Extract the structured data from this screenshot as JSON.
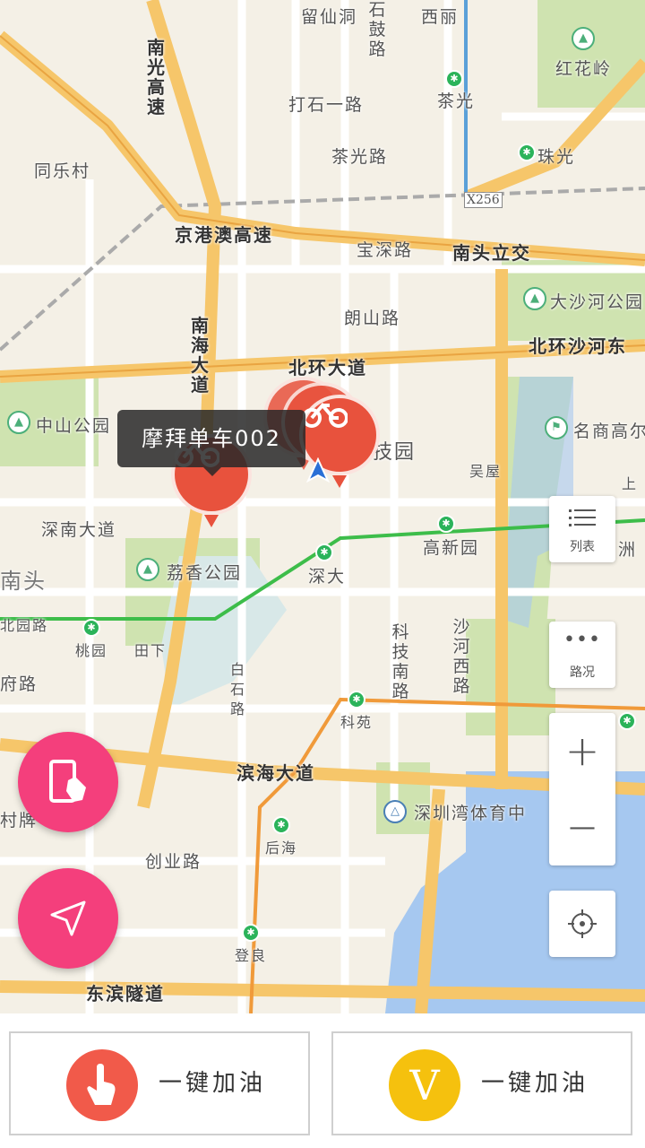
{
  "map": {
    "labels": {
      "liuxiandong": "留仙洞",
      "shigulu": "石鼓路",
      "xili": "西丽",
      "nanguanggaosu": "南光高速",
      "dashiyilu": "打石一路",
      "chaguang_station": "茶光",
      "honghualing": "红花岭",
      "tongle": "同乐村",
      "chaguanglu": "茶光路",
      "zhuguang": "珠光",
      "x256": "X256",
      "jinggangao": "京港澳高速",
      "baoshenlu": "宝深路",
      "nantoulijiao": "南头立交",
      "langshanlu": "朗山路",
      "dashahe_park": "大沙河公园",
      "nanhaidadao": "南海大道",
      "beihuandadao": "北环大道",
      "beihuan_shahe": "北环沙河东",
      "zhongshan_park": "中山公园",
      "keji_yuan": "科技园",
      "mingshang": "名商高尔",
      "wuwu": "吴屋",
      "shenandadao": "深南大道",
      "gaoxinyuan": "高新园",
      "lixiang_park": "荔香公园",
      "shenda": "深大",
      "nantou": "南头",
      "beihuanlu": "北园路",
      "taoyuan": "桃园",
      "tianxia": "田下",
      "kejinanlu": "科技南路",
      "shahexilu": "沙河西路",
      "fulu": "府路",
      "baishilu": "白石路",
      "keyuan": "科苑",
      "binhaidadao": "滨海大道",
      "shenzhenwan": "深圳湾体育中",
      "houhai": "后海",
      "cunpai": "村牌",
      "chuangyelu": "创业路",
      "dengliang": "登良",
      "dongbinsuidao": "东滨隧道",
      "zhou": "洲",
      "shang": "上"
    },
    "tooltip": "摩拜单车002"
  },
  "controls": {
    "list_label": "列表",
    "traffic_label": "路况",
    "zoom_in": "+",
    "zoom_out": "—"
  },
  "bottom": {
    "left_label": "一键加油",
    "right_label": "一键加油",
    "right_icon_letter": "V"
  },
  "colors": {
    "pin": "#e8523d",
    "fab": "#f43f7c",
    "left_btn_icon": "#f15a4a",
    "right_btn_icon": "#f5c10e"
  }
}
